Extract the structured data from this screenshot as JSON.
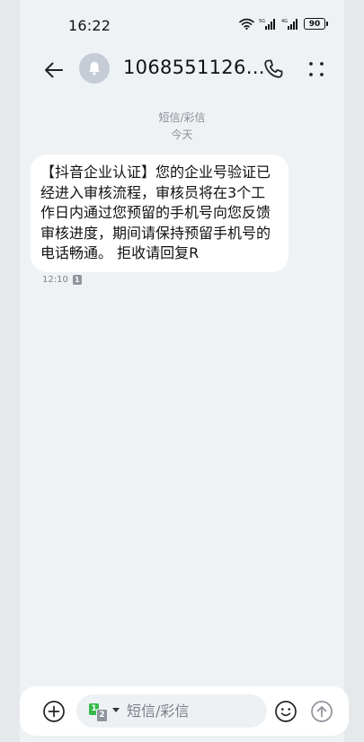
{
  "status_bar": {
    "time": "16:22",
    "battery": "90",
    "icons": [
      "wifi-icon",
      "signal-icon",
      "signal-icon",
      "battery-icon"
    ]
  },
  "header": {
    "contact": "1068551126…",
    "icons": [
      "back-arrow-icon",
      "bell-icon",
      "phone-icon",
      "more-icon"
    ]
  },
  "conversation": {
    "message_type": "短信/彩信",
    "day": "今天",
    "messages": [
      {
        "text": "【抖音企业认证】您的企业号验证已经进入审核流程，审核员将在3个工作日内通过您预留的手机号向您反馈审核进度，期间请保持预留手机号的电话畅通。 拒收请回复R",
        "time": "12:10",
        "sim": "1"
      }
    ]
  },
  "input_bar": {
    "placeholder": "短信/彩信",
    "sim_primary": "1",
    "sim_secondary": "2",
    "icons": [
      "add-icon",
      "emoji-icon",
      "send-icon"
    ]
  },
  "colors": {
    "background": "#eef2f5",
    "bubble": "#ffffff",
    "sim_active": "#35b94b"
  }
}
